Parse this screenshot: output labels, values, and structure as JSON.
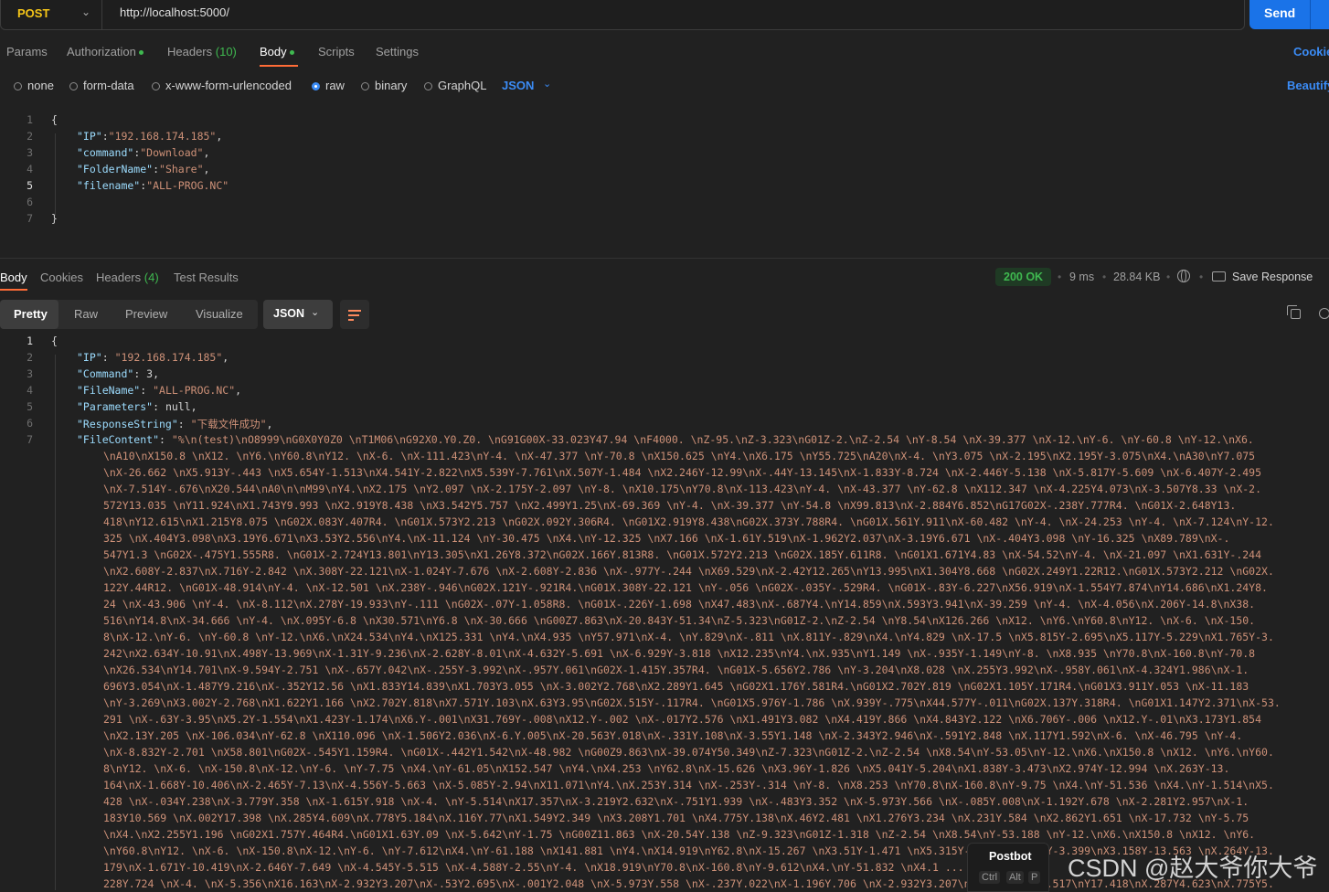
{
  "request": {
    "method": "POST",
    "url": "http://localhost:5000/",
    "send_label": "Send"
  },
  "request_tabs": {
    "params": "Params",
    "authorization": "Authorization",
    "headers": "Headers",
    "headers_count": "(10)",
    "body": "Body",
    "scripts": "Scripts",
    "settings": "Settings",
    "cookies": "Cookie"
  },
  "body_types": {
    "none": "none",
    "form_data": "form-data",
    "urlencoded": "x-www-form-urlencoded",
    "raw": "raw",
    "binary": "binary",
    "graphql": "GraphQL",
    "selected": "raw",
    "format": "JSON",
    "beautify": "Beautify"
  },
  "request_body": {
    "line_numbers": [
      "1",
      "2",
      "3",
      "4",
      "5",
      "6",
      "7"
    ],
    "brace_open": "{",
    "brace_close": "}",
    "fields": [
      {
        "key": "\"IP\"",
        "sep": ":",
        "value": "\"192.168.174.185\"",
        "tail": ","
      },
      {
        "key": "\"command\"",
        "sep": ":",
        "value": "\"Download\"",
        "tail": ","
      },
      {
        "key": "\"FolderName\"",
        "sep": ":",
        "value": "\"Share\"",
        "tail": ","
      },
      {
        "key": "\"filename\"",
        "sep": ":",
        "value": "\"ALL-PROG.NC\"",
        "tail": ""
      }
    ]
  },
  "response_tabs": {
    "body": "Body",
    "cookies": "Cookies",
    "headers": "Headers",
    "headers_count": "(4)",
    "test_results": "Test Results",
    "status": "200 OK",
    "time": "9 ms",
    "size": "28.84 KB",
    "save_response": "Save Response"
  },
  "view_modes": {
    "pretty": "Pretty",
    "raw": "Raw",
    "preview": "Preview",
    "visualize": "Visualize",
    "format": "JSON"
  },
  "response_body": {
    "line_numbers": [
      "1",
      "2",
      "3",
      "4",
      "5",
      "6",
      "7"
    ],
    "brace_open": "{",
    "fields": [
      {
        "key": "\"IP\"",
        "sep": ": ",
        "value": "\"192.168.174.185\"",
        "tail": ","
      },
      {
        "key": "\"Command\"",
        "sep": ": ",
        "value": "3",
        "tail": ","
      },
      {
        "key": "\"FileName\"",
        "sep": ": ",
        "value": "\"ALL-PROG.NC\"",
        "tail": ","
      },
      {
        "key": "\"Parameters\"",
        "sep": ": ",
        "value": "null",
        "tail": ","
      },
      {
        "key": "\"ResponseString\"",
        "sep": ": ",
        "value": "\"下载文件成功\"",
        "tail": ","
      }
    ],
    "filecontent_key": "\"FileContent\"",
    "filecontent_first": "\"%\\n(test)\\nO8999\\nG0X0Y0Z0 \\nT1M06\\nG92X0.Y0.Z0. \\nG91G00X-33.023Y47.94 \\nF4000. \\nZ-95.\\nZ-3.323\\nG01Z-2.\\nZ-2.54 \\nY-8.54 \\nX-39.377 \\nX-12.\\nY-6. \\nY-60.8 \\nY-12.\\nX6.",
    "filecontent_lines": [
      "\\nA10\\nX150.8 \\nX12. \\nY6.\\nY60.8\\nY12. \\nX-6. \\nX-111.423\\nY-4. \\nX-47.377 \\nY-70.8 \\nX150.625 \\nY4.\\nX6.175 \\nY55.725\\nA20\\nX-4. \\nY3.075 \\nX-2.195\\nX2.195Y-3.075\\nX4.\\nA30\\nY7.075",
      "\\nX-26.662 \\nX5.913Y-.443 \\nX5.654Y-1.513\\nX4.541Y-2.822\\nX5.539Y-7.761\\nX.507Y-1.484 \\nX2.246Y-12.99\\nX-.44Y-13.145\\nX-1.833Y-8.724 \\nX-2.446Y-5.138 \\nX-5.817Y-5.609 \\nX-6.407Y-2.495",
      "\\nX-7.514Y-.676\\nX20.544\\nA0\\n\\nM99\\nY4.\\nX2.175 \\nY2.097 \\nX-2.175Y-2.097 \\nY-8. \\nX10.175\\nY70.8\\nX-113.423\\nY-4. \\nX-43.377 \\nY-62.8 \\nX112.347 \\nX-4.225Y4.073\\nX-3.507Y8.33 \\nX-2.",
      "572Y13.035 \\nY11.924\\nX1.743Y9.993 \\nX2.919Y8.438 \\nX3.542Y5.757 \\nX2.499Y1.25\\nX-69.369 \\nY-4. \\nX-39.377 \\nY-54.8 \\nX99.813\\nX-2.884Y6.852\\nG17G02X-.238Y.777R4. \\nG01X-2.648Y13.",
      "418\\nY12.615\\nX1.215Y8.075 \\nG02X.083Y.407R4. \\nG01X.573Y2.213 \\nG02X.092Y.306R4. \\nG01X2.919Y8.438\\nG02X.373Y.788R4. \\nG01X.561Y.911\\nX-60.482 \\nY-4. \\nX-24.253 \\nY-4. \\nX-7.124\\nY-12.",
      "325 \\nX.404Y3.098\\nX3.19Y6.671\\nX3.53Y2.556\\nY4.\\nX-11.124 \\nY-30.475 \\nX4.\\nY-12.325 \\nX7.166 \\nX-1.61Y.519\\nX-1.962Y2.037\\nX-3.19Y6.671 \\nX-.404Y3.098 \\nY-16.325 \\nX89.789\\nX-.",
      "547Y1.3 \\nG02X-.475Y1.555R8. \\nG01X-2.724Y13.801\\nY13.305\\nX1.26Y8.372\\nG02X.166Y.813R8. \\nG01X.572Y2.213 \\nG02X.185Y.611R8. \\nG01X1.671Y4.83 \\nX-54.52\\nY-4. \\nX-21.097 \\nX1.631Y-.244",
      "\\nX2.608Y-2.837\\nX.716Y-2.842 \\nX.308Y-22.121\\nX-1.024Y-7.676 \\nX-2.608Y-2.836 \\nX-.977Y-.244 \\nX69.529\\nX-2.42Y12.265\\nY13.995\\nX1.304Y8.668 \\nG02X.249Y1.22R12.\\nG01X.573Y2.212 \\nG02X.",
      "122Y.44R12. \\nG01X-48.914\\nY-4. \\nX-12.501 \\nX.238Y-.946\\nG02X.121Y-.921R4.\\nG01X.308Y-22.121 \\nY-.056 \\nG02X-.035Y-.529R4. \\nG01X-.83Y-6.227\\nX56.919\\nX-1.554Y7.874\\nY14.686\\nX1.24Y8.",
      "24 \\nX-43.906 \\nY-4. \\nX-8.112\\nX.278Y-19.933\\nY-.111 \\nG02X-.07Y-1.058R8. \\nG01X-.226Y-1.698 \\nX47.483\\nX-.687Y4.\\nY14.859\\nX.593Y3.941\\nX-39.259 \\nY-4. \\nX-4.056\\nX.206Y-14.8\\nX38.",
      "516\\nY14.8\\nX-34.666 \\nY-4. \\nX.095Y-6.8 \\nX30.571\\nY6.8 \\nX-30.666 \\nG00Z7.863\\nX-20.843Y-51.34\\nZ-5.323\\nG01Z-2.\\nZ-2.54 \\nY8.54\\nX126.266 \\nX12. \\nY6.\\nY60.8\\nY12. \\nX-6. \\nX-150.",
      "8\\nX-12.\\nY-6. \\nY-60.8 \\nY-12.\\nX6.\\nX24.534\\nY4.\\nX125.331 \\nY4.\\nX4.935 \\nY57.971\\nX-4. \\nY.829\\nX-.811 \\nX.811Y-.829\\nX4.\\nY4.829 \\nX-17.5 \\nX5.815Y-2.695\\nX5.117Y-5.229\\nX1.765Y-3.",
      "242\\nX2.634Y-10.91\\nX.498Y-13.969\\nX-1.31Y-9.236\\nX-2.628Y-8.01\\nX-4.632Y-5.691 \\nX-6.929Y-3.818 \\nX12.235\\nY4.\\nX.935\\nY1.149 \\nX-.935Y-1.149\\nY-8. \\nX8.935 \\nY70.8\\nX-160.8\\nY-70.8",
      "\\nX26.534\\nY14.701\\nX-9.594Y-2.751 \\nX-.657Y.042\\nX-.255Y-3.992\\nX-.957Y.061\\nG02X-1.415Y.357R4. \\nG01X-5.656Y2.786 \\nY-3.204\\nX8.028 \\nX.255Y3.992\\nX-.958Y.061\\nX-4.324Y1.986\\nX-1.",
      "696Y3.054\\nX-1.487Y9.216\\nX-.352Y12.56 \\nX1.833Y14.839\\nX1.703Y3.055 \\nX-3.002Y2.768\\nX2.289Y1.645 \\nG02X1.176Y.581R4.\\nG01X2.702Y.819 \\nG02X1.105Y.171R4.\\nG01X3.911Y.053 \\nX-11.183",
      "\\nY-3.269\\nX3.002Y-2.768\\nX1.622Y1.166 \\nX2.702Y.818\\nX7.571Y.103\\nX.63Y3.95\\nG02X.515Y-.117R4. \\nG01X5.976Y-1.786 \\nX.939Y-.775\\nX44.577Y-.011\\nG02X.137Y.318R4. \\nG01X1.147Y2.371\\nX-53.",
      "291 \\nX-.63Y-3.95\\nX5.2Y-1.554\\nX1.423Y-1.174\\nX6.Y-.001\\nX31.769Y-.008\\nX12.Y-.002 \\nX-.017Y2.576 \\nX1.491Y3.082 \\nX4.419Y.866 \\nX4.843Y2.122 \\nX6.706Y-.006 \\nX12.Y-.01\\nX3.173Y1.854",
      "\\nX2.13Y.205 \\nX-106.034\\nY-62.8 \\nX110.096 \\nX-1.506Y2.036\\nX-6.Y.005\\nX-20.563Y.018\\nX-.331Y.108\\nX-3.55Y1.148 \\nX-2.343Y2.946\\nX-.591Y2.848 \\nX.117Y1.592\\nX-6. \\nX-46.795 \\nY-4.",
      "\\nX-8.832Y-2.701 \\nX58.801\\nG02X-.545Y1.159R4. \\nG01X-.442Y1.542\\nX-48.982 \\nG00Z9.863\\nX-39.074Y50.349\\nZ-7.323\\nG01Z-2.\\nZ-2.54 \\nX8.54\\nY-53.05\\nY-12.\\nX6.\\nX150.8 \\nX12. \\nY6.\\nY60.",
      "8\\nY12. \\nX-6. \\nX-150.8\\nX-12.\\nY-6. \\nY-7.75 \\nX4.\\nY-61.05\\nX152.547 \\nY4.\\nX4.253 \\nY62.8\\nX-15.626 \\nX3.96Y-1.826 \\nX5.041Y-5.204\\nX1.838Y-3.473\\nX2.974Y-12.994 \\nX.263Y-13.",
      "164\\nX-1.668Y-10.406\\nX-2.465Y-7.13\\nX-4.556Y-5.663 \\nX-5.085Y-2.94\\nX11.071\\nY4.\\nX.253Y.314 \\nX-.253Y-.314 \\nY-8. \\nX8.253 \\nY70.8\\nX-160.8\\nY-9.75 \\nX4.\\nY-51.536 \\nX4.\\nY-1.514\\nX5.",
      "428 \\nX-.034Y.238\\nX-3.779Y.358 \\nX-1.615Y.918 \\nX-4. \\nY-5.514\\nX17.357\\nX-3.219Y2.632\\nX-.751Y1.939 \\nX-.483Y3.352 \\nX-5.973Y.566 \\nX-.085Y.008\\nX-1.192Y.678 \\nX-2.281Y2.957\\nX-1.",
      "183Y10.569 \\nX.002Y17.398 \\nX.285Y4.609\\nX.778Y5.184\\nX.116Y.77\\nX1.549Y2.349 \\nX3.208Y1.701 \\nX4.775Y.138\\nX.46Y2.481 \\nX1.276Y3.234 \\nX.231Y.584 \\nX2.862Y1.651 \\nX-17.732 \\nY-5.75",
      "\\nX4.\\nX2.255Y1.196 \\nG02X1.757Y.464R4.\\nG01X1.63Y.09 \\nX-5.642\\nY-1.75 \\nG00Z11.863 \\nX-20.54Y.138 \\nZ-9.323\\nG01Z-1.318 \\nZ-2.54 \\nX8.54\\nY-53.188 \\nY-12.\\nX6.\\nX150.8 \\nX12. \\nY6.",
      "\\nY60.8\\nY12. \\nX-6. \\nX-150.8\\nX-12.\\nY-6. \\nY-7.612\\nX4.\\nY-61.188 \\nX141.881 \\nY4.\\nX14.919\\nY62.8\\nX-15.267 \\nX3.51Y-1.471 \\nX5.315Y-3.99\\nX1.835Y-3.399\\nX3.158Y-13.563 \\nX.264Y-13.",
      "179\\nX-1.671Y-10.419\\nX-2.646Y-7.649 \\nX-4.545Y-5.515 \\nX-4.588Y-2.55\\nY-4. \\nX18.919\\nY70.8\\nX-160.8\\nY-9.612\\nX4.\\nY-51.832 \\nX4.1 ... ",
      "228Y.724 \\nX-4. \\nX-5.356\\nX16.163\\nX-2.932Y3.207\\nX-.53Y2.695\\nX-.001Y2.048 \\nX-5.973Y.558 \\nX-.237Y.022\\nX-1.196Y.706 \\nX-2.932Y3.207\\nX-1.0 ... 10.517\\nY17.418\\nX.287Y4.623\\nX.775Y5."
    ]
  },
  "postbot": {
    "label": "Postbot",
    "keys": [
      "Ctrl",
      "Alt",
      "P"
    ]
  },
  "watermark": "CSDN @赵大爷你大爷"
}
